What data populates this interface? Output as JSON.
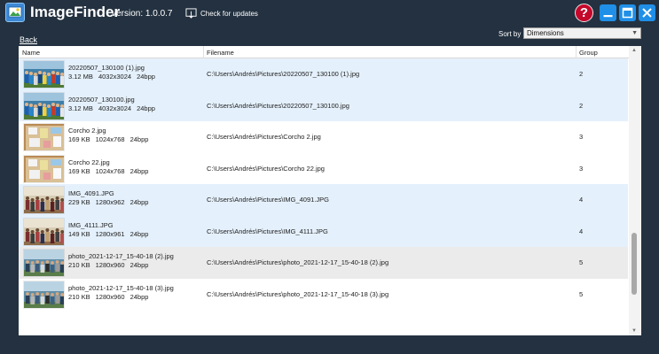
{
  "app": {
    "title": "ImageFinder",
    "version": "Version: 1.0.0.7",
    "update_label": "Check for updates",
    "back_label": "Back"
  },
  "window_buttons": {
    "help": "?"
  },
  "sort": {
    "label": "Sort by",
    "selected": "Dimensions"
  },
  "columns": {
    "name": "Name",
    "filename": "Filename",
    "group": "Group"
  },
  "rows": [
    {
      "name": "20220507_130100 (1).jpg",
      "size": "3.12 MB",
      "dims": "4032x3024",
      "bpp": "24bpp",
      "path": "C:\\Users\\Andrés\\Pictures\\20220507_130100 (1).jpg",
      "group": "2",
      "theme": "blue",
      "thumb": "crowd"
    },
    {
      "name": "20220507_130100.jpg",
      "size": "3.12 MB",
      "dims": "4032x3024",
      "bpp": "24bpp",
      "path": "C:\\Users\\Andrés\\Pictures\\20220507_130100.jpg",
      "group": "2",
      "theme": "blue",
      "thumb": "crowd"
    },
    {
      "name": "Corcho 2.jpg",
      "size": "169 KB",
      "dims": "1024x768",
      "bpp": "24bpp",
      "path": "C:\\Users\\Andrés\\Pictures\\Corcho 2.jpg",
      "group": "3",
      "theme": "white",
      "thumb": "board"
    },
    {
      "name": "Corcho 22.jpg",
      "size": "169 KB",
      "dims": "1024x768",
      "bpp": "24bpp",
      "path": "C:\\Users\\Andrés\\Pictures\\Corcho 22.jpg",
      "group": "3",
      "theme": "white",
      "thumb": "board"
    },
    {
      "name": "IMG_4091.JPG",
      "size": "229 KB",
      "dims": "1280x962",
      "bpp": "24bpp",
      "path": "C:\\Users\\Andrés\\Pictures\\IMG_4091.JPG",
      "group": "4",
      "theme": "blue",
      "thumb": "class"
    },
    {
      "name": "IMG_4111.JPG",
      "size": "149 KB",
      "dims": "1280x961",
      "bpp": "24bpp",
      "path": "C:\\Users\\Andrés\\Pictures\\IMG_4111.JPG",
      "group": "4",
      "theme": "blue",
      "thumb": "class"
    },
    {
      "name": "photo_2021-12-17_15-40-18 (2).jpg",
      "size": "210 KB",
      "dims": "1280x960",
      "bpp": "24bpp",
      "path": "C:\\Users\\Andrés\\Pictures\\photo_2021-12-17_15-40-18 (2).jpg",
      "group": "5",
      "theme": "sel",
      "thumb": "outdoor"
    },
    {
      "name": "photo_2021-12-17_15-40-18 (3).jpg",
      "size": "210 KB",
      "dims": "1280x960",
      "bpp": "24bpp",
      "path": "C:\\Users\\Andrés\\Pictures\\photo_2021-12-17_15-40-18 (3).jpg",
      "group": "5",
      "theme": "white",
      "thumb": "outdoor"
    }
  ],
  "scroll": {
    "position": 0.85
  },
  "colors": {
    "background": "#233140",
    "accent": "#1f8fe8",
    "help": "#c4072b",
    "row_blue": "#e4f0fb",
    "row_selected": "#ebebeb"
  },
  "icons": [
    "app-logo-icon",
    "download-icon",
    "help-icon",
    "minimize-icon",
    "maximize-icon",
    "close-icon"
  ]
}
